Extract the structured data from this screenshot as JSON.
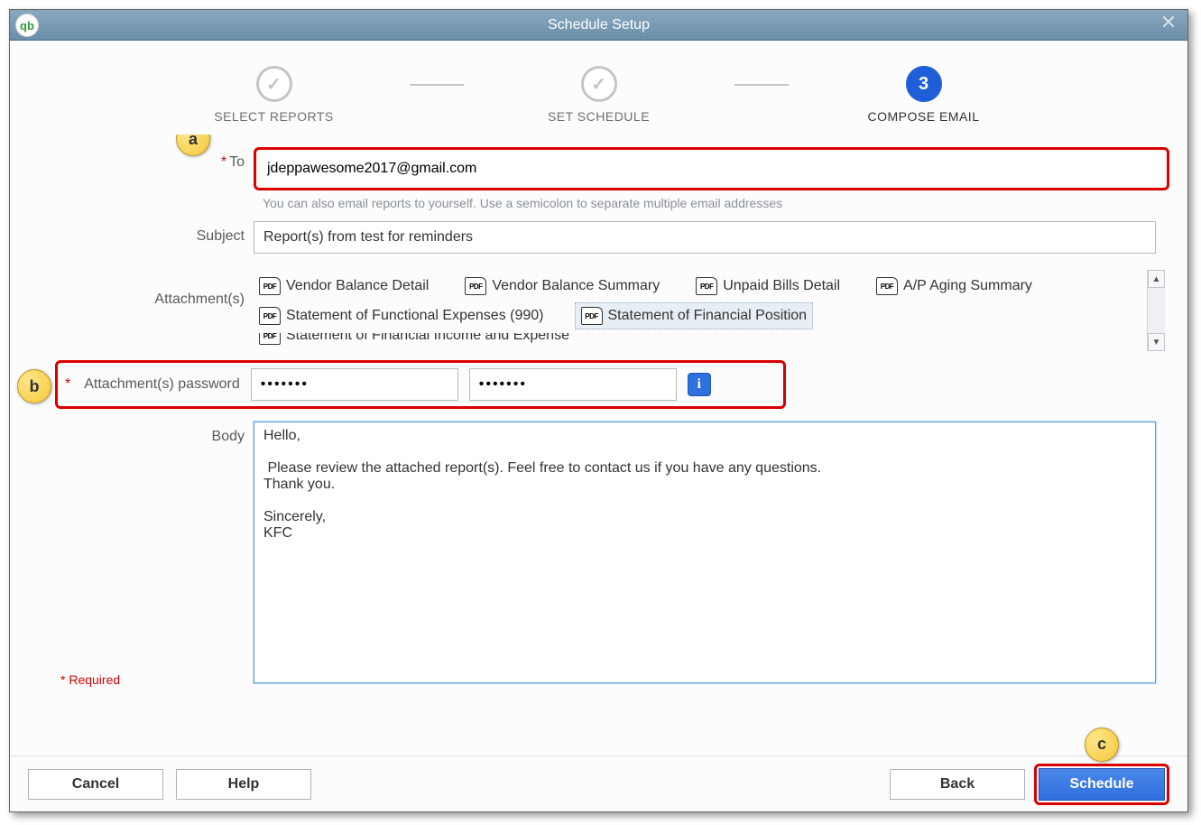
{
  "window": {
    "title": "Schedule Setup",
    "logo_text": "qb"
  },
  "stepper": {
    "steps": [
      {
        "label": "SELECT REPORTS",
        "state": "done"
      },
      {
        "label": "SET SCHEDULE",
        "state": "done"
      },
      {
        "label": "COMPOSE EMAIL",
        "state": "active",
        "num": "3"
      }
    ]
  },
  "form": {
    "to_label": "To",
    "to_value": "jdeppawesome2017@gmail.com",
    "to_hint": "You can also email reports to yourself. Use a semicolon to separate multiple email addresses",
    "subject_label": "Subject",
    "subject_value": "Report(s) from test for reminders",
    "attachments_label": "Attachment(s)",
    "attachments": [
      {
        "name": "Vendor Balance Detail"
      },
      {
        "name": "Vendor Balance Summary"
      },
      {
        "name": "Unpaid Bills Detail"
      },
      {
        "name": "A/P Aging Summary"
      },
      {
        "name": "Statement of Functional Expenses (990)"
      },
      {
        "name": "Statement of Financial Position",
        "selected": true
      }
    ],
    "attachment_cutoff": "Statement of Financial Income and Expense",
    "pwd_label": "Attachment(s) password",
    "pwd1": "•••••••",
    "pwd2": "•••••••",
    "body_label": "Body",
    "body_value": "Hello,\n\n Please review the attached report(s). Feel free to contact us if you have any questions.\nThank you.\n\nSincerely,\nKFC",
    "required_note": "* Required"
  },
  "footer": {
    "cancel": "Cancel",
    "help": "Help",
    "back": "Back",
    "schedule": "Schedule"
  },
  "callouts": {
    "a": "a",
    "b": "b",
    "c": "c"
  }
}
